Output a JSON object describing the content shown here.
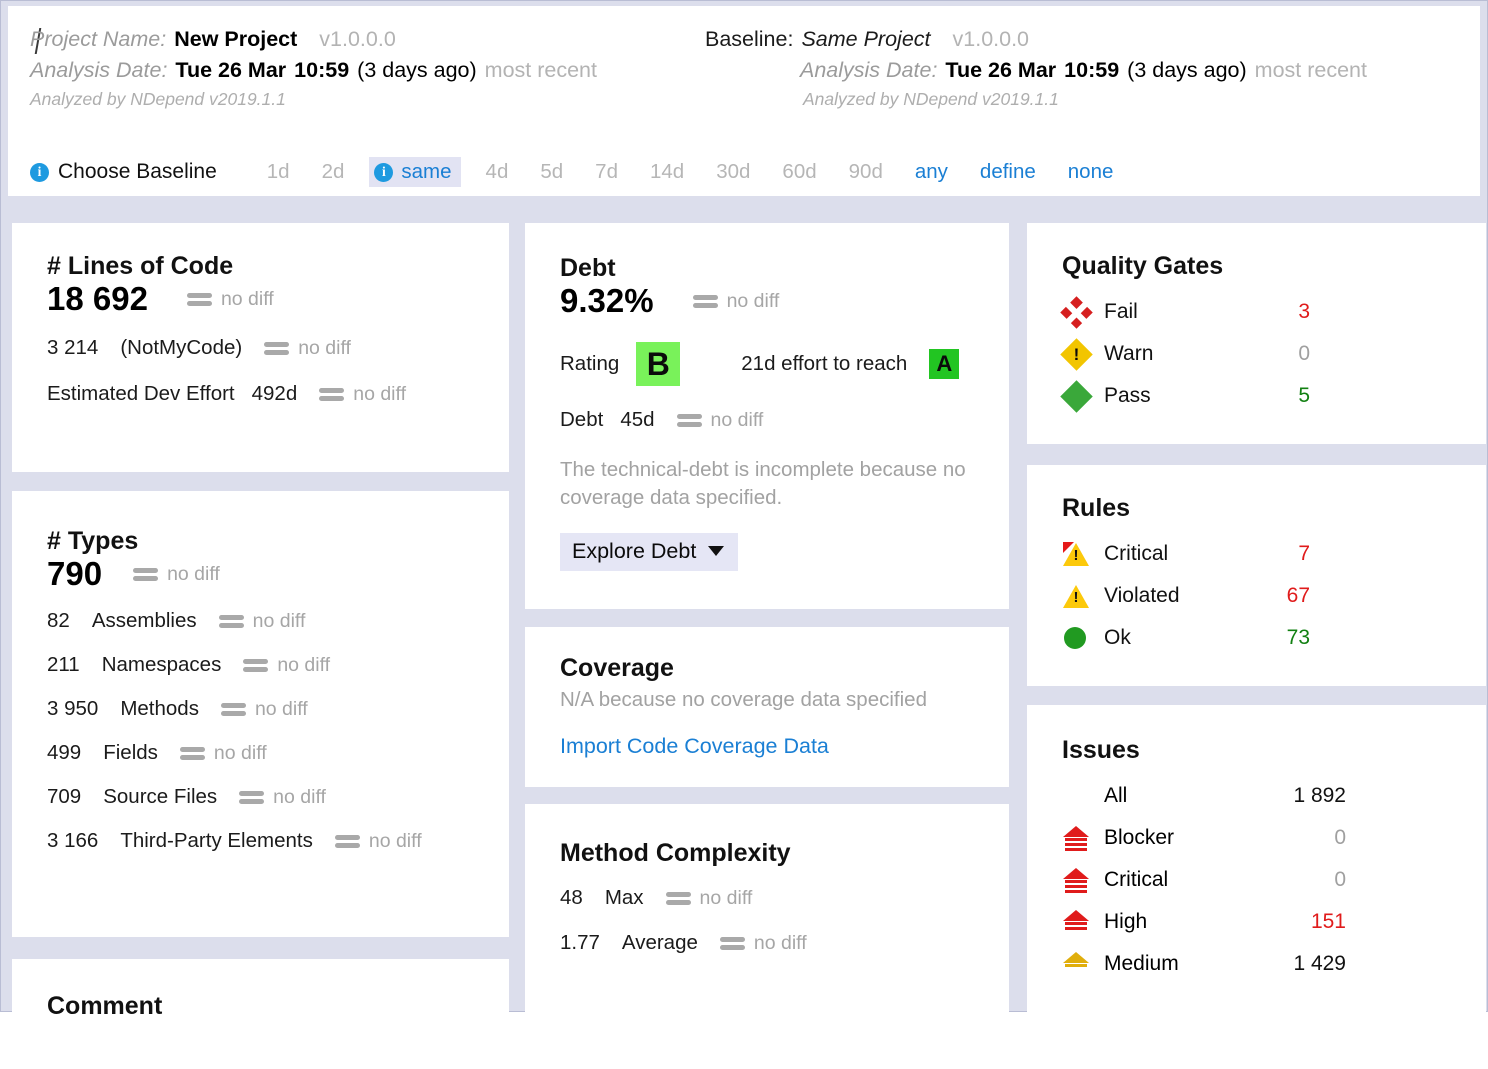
{
  "header": {
    "project": {
      "name_label": "Project Name:",
      "name_value": "New Project",
      "version": "v1.0.0.0",
      "date_label": "Analysis Date:",
      "date_value": "Tue 26 Mar",
      "time_value": "10:59",
      "ago": "(3 days ago)",
      "recency": "most recent",
      "analyzed_by": "Analyzed by NDepend v2019.1.1"
    },
    "baseline": {
      "baseline_label": "Baseline:",
      "baseline_value": "Same Project",
      "version": "v1.0.0.0",
      "date_label": "Analysis Date:",
      "date_value": "Tue 26 Mar",
      "time_value": "10:59",
      "ago": "(3 days ago)",
      "recency": "most recent",
      "analyzed_by": "Analyzed by NDepend v2019.1.1"
    }
  },
  "baseline_selector": {
    "info_glyph": "i",
    "label": "Choose Baseline",
    "options": [
      {
        "label": "1d",
        "state": "inactive"
      },
      {
        "label": "2d",
        "state": "inactive"
      },
      {
        "label": "same",
        "state": "active"
      },
      {
        "label": "4d",
        "state": "inactive"
      },
      {
        "label": "5d",
        "state": "inactive"
      },
      {
        "label": "7d",
        "state": "inactive"
      },
      {
        "label": "14d",
        "state": "inactive"
      },
      {
        "label": "30d",
        "state": "inactive"
      },
      {
        "label": "60d",
        "state": "inactive"
      },
      {
        "label": "90d",
        "state": "inactive"
      },
      {
        "label": "any",
        "state": "link"
      },
      {
        "label": "define",
        "state": "link"
      },
      {
        "label": "none",
        "state": "link"
      }
    ]
  },
  "lines_of_code": {
    "title": "# Lines of Code",
    "value": "18 692",
    "value_diff": "no diff",
    "notmycode_value": "3 214",
    "notmycode_label": "(NotMyCode)",
    "notmycode_diff": "no diff",
    "effort_label": "Estimated Dev Effort",
    "effort_value": "492d",
    "effort_diff": "no diff"
  },
  "types": {
    "title": "# Types",
    "value": "790",
    "value_diff": "no diff",
    "rows": [
      {
        "count": "82",
        "label": "Assemblies",
        "diff": "no diff"
      },
      {
        "count": "211",
        "label": "Namespaces",
        "diff": "no diff"
      },
      {
        "count": "3 950",
        "label": "Methods",
        "diff": "no diff"
      },
      {
        "count": "499",
        "label": "Fields",
        "diff": "no diff"
      },
      {
        "count": "709",
        "label": "Source Files",
        "diff": "no diff"
      },
      {
        "count": "3 166",
        "label": "Third-Party Elements",
        "diff": "no diff"
      }
    ]
  },
  "comment": {
    "title": "Comment"
  },
  "debt": {
    "title": "Debt",
    "percent": "9.32%",
    "percent_diff": "no diff",
    "rating_label": "Rating",
    "rating_grade": "B",
    "effort_text": "21d effort to reach",
    "target_grade": "A",
    "debt_label": "Debt",
    "debt_value": "45d",
    "debt_diff": "no diff",
    "note": "The technical-debt is incomplete because no coverage data specified.",
    "explore_button": "Explore Debt",
    "rating_color": "#79f25a",
    "target_color": "#22c522"
  },
  "coverage": {
    "title": "Coverage",
    "subtitle": "N/A because no coverage data specified",
    "link": "Import Code Coverage Data"
  },
  "method_complexity": {
    "title": "Method Complexity",
    "rows": [
      {
        "value": "48",
        "label": "Max",
        "diff": "no diff"
      },
      {
        "value": "1.77",
        "label": "Average",
        "diff": "no diff"
      }
    ]
  },
  "quality_gates": {
    "title": "Quality Gates",
    "rows": [
      {
        "icon": "fail-diamond-icon",
        "label": "Fail",
        "count": "3",
        "color": "#e01b1b"
      },
      {
        "icon": "warn-diamond-icon",
        "label": "Warn",
        "count": "0",
        "color": "#a0a0a0"
      },
      {
        "icon": "pass-diamond-icon",
        "label": "Pass",
        "count": "5",
        "color": "#128012"
      }
    ]
  },
  "rules": {
    "title": "Rules",
    "rows": [
      {
        "icon": "critical-warning-icon",
        "label": "Critical",
        "count": "7",
        "color": "#e01b1b"
      },
      {
        "icon": "warning-triangle-icon",
        "label": "Violated",
        "count": "67",
        "color": "#e01b1b"
      },
      {
        "icon": "ok-circle-icon",
        "label": "Ok",
        "count": "73",
        "color": "#128012"
      }
    ]
  },
  "issues": {
    "title": "Issues",
    "rows": [
      {
        "icon": "none",
        "label": "All",
        "count": "1 892",
        "color": "#111111"
      },
      {
        "icon": "severity-blocker-icon",
        "label": "Blocker",
        "count": "0",
        "color": "#a0a0a0"
      },
      {
        "icon": "severity-critical-icon",
        "label": "Critical",
        "count": "0",
        "color": "#a0a0a0"
      },
      {
        "icon": "severity-high-icon",
        "label": "High",
        "count": "151",
        "color": "#e01b1b"
      },
      {
        "icon": "severity-medium-icon",
        "label": "Medium",
        "count": "1 429",
        "color": "#111111"
      }
    ]
  }
}
